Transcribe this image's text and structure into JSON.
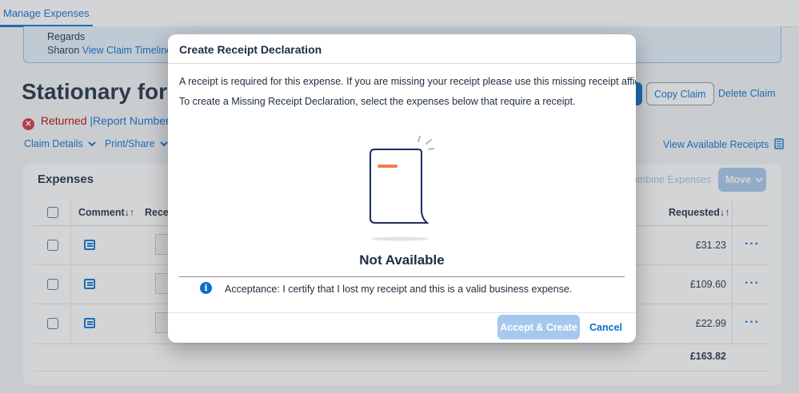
{
  "topnav": {
    "tab": "Manage Expenses"
  },
  "notice": {
    "line1": "Regards",
    "name": "Sharon",
    "timeline_link": "View Claim Timeline"
  },
  "page": {
    "title": "Stationary for"
  },
  "status": {
    "label": "Returned",
    "report_number_label": "|Report Number:"
  },
  "toolbar": {
    "claim_details": "Claim Details",
    "print_share": "Print/Share",
    "view_receipts": "View Available Receipts"
  },
  "header_actions": {
    "copy_claim": "Copy Claim",
    "delete_claim": "Delete Claim"
  },
  "expenses": {
    "title": "Expenses",
    "combine": "ombine Expenses",
    "move": "Move",
    "columns": {
      "comment": "Comment",
      "receipt": "Recei",
      "requested": "Requested"
    },
    "rows": [
      {
        "amount": "£31.23"
      },
      {
        "amount": "£109.60"
      },
      {
        "amount": "£22.99"
      }
    ],
    "total": "£163.82"
  },
  "dialog": {
    "title": "Create Receipt Declaration",
    "text1": "A receipt is required for this expense. If you are missing your receipt please use this missing receipt affidavit.",
    "text2": "To create a Missing Receipt Declaration, select the expenses below that require a receipt.",
    "empty_state": "Not Available",
    "acceptance": "Acceptance: I certify that I lost my receipt and this is a valid business expense.",
    "accept_button": "Accept & Create",
    "cancel_button": "Cancel"
  },
  "colors": {
    "accent": "#0a6ed1",
    "error": "#bb0000",
    "illustration_accent": "#ef7d4a",
    "illustration_stroke": "#1d2d5c"
  },
  "icons": [
    "error-circle-icon",
    "chevron-down-icon",
    "receipt-list-icon",
    "sort-icon",
    "comment-icon",
    "overflow-icon",
    "info-icon",
    "receipt-illustration"
  ]
}
